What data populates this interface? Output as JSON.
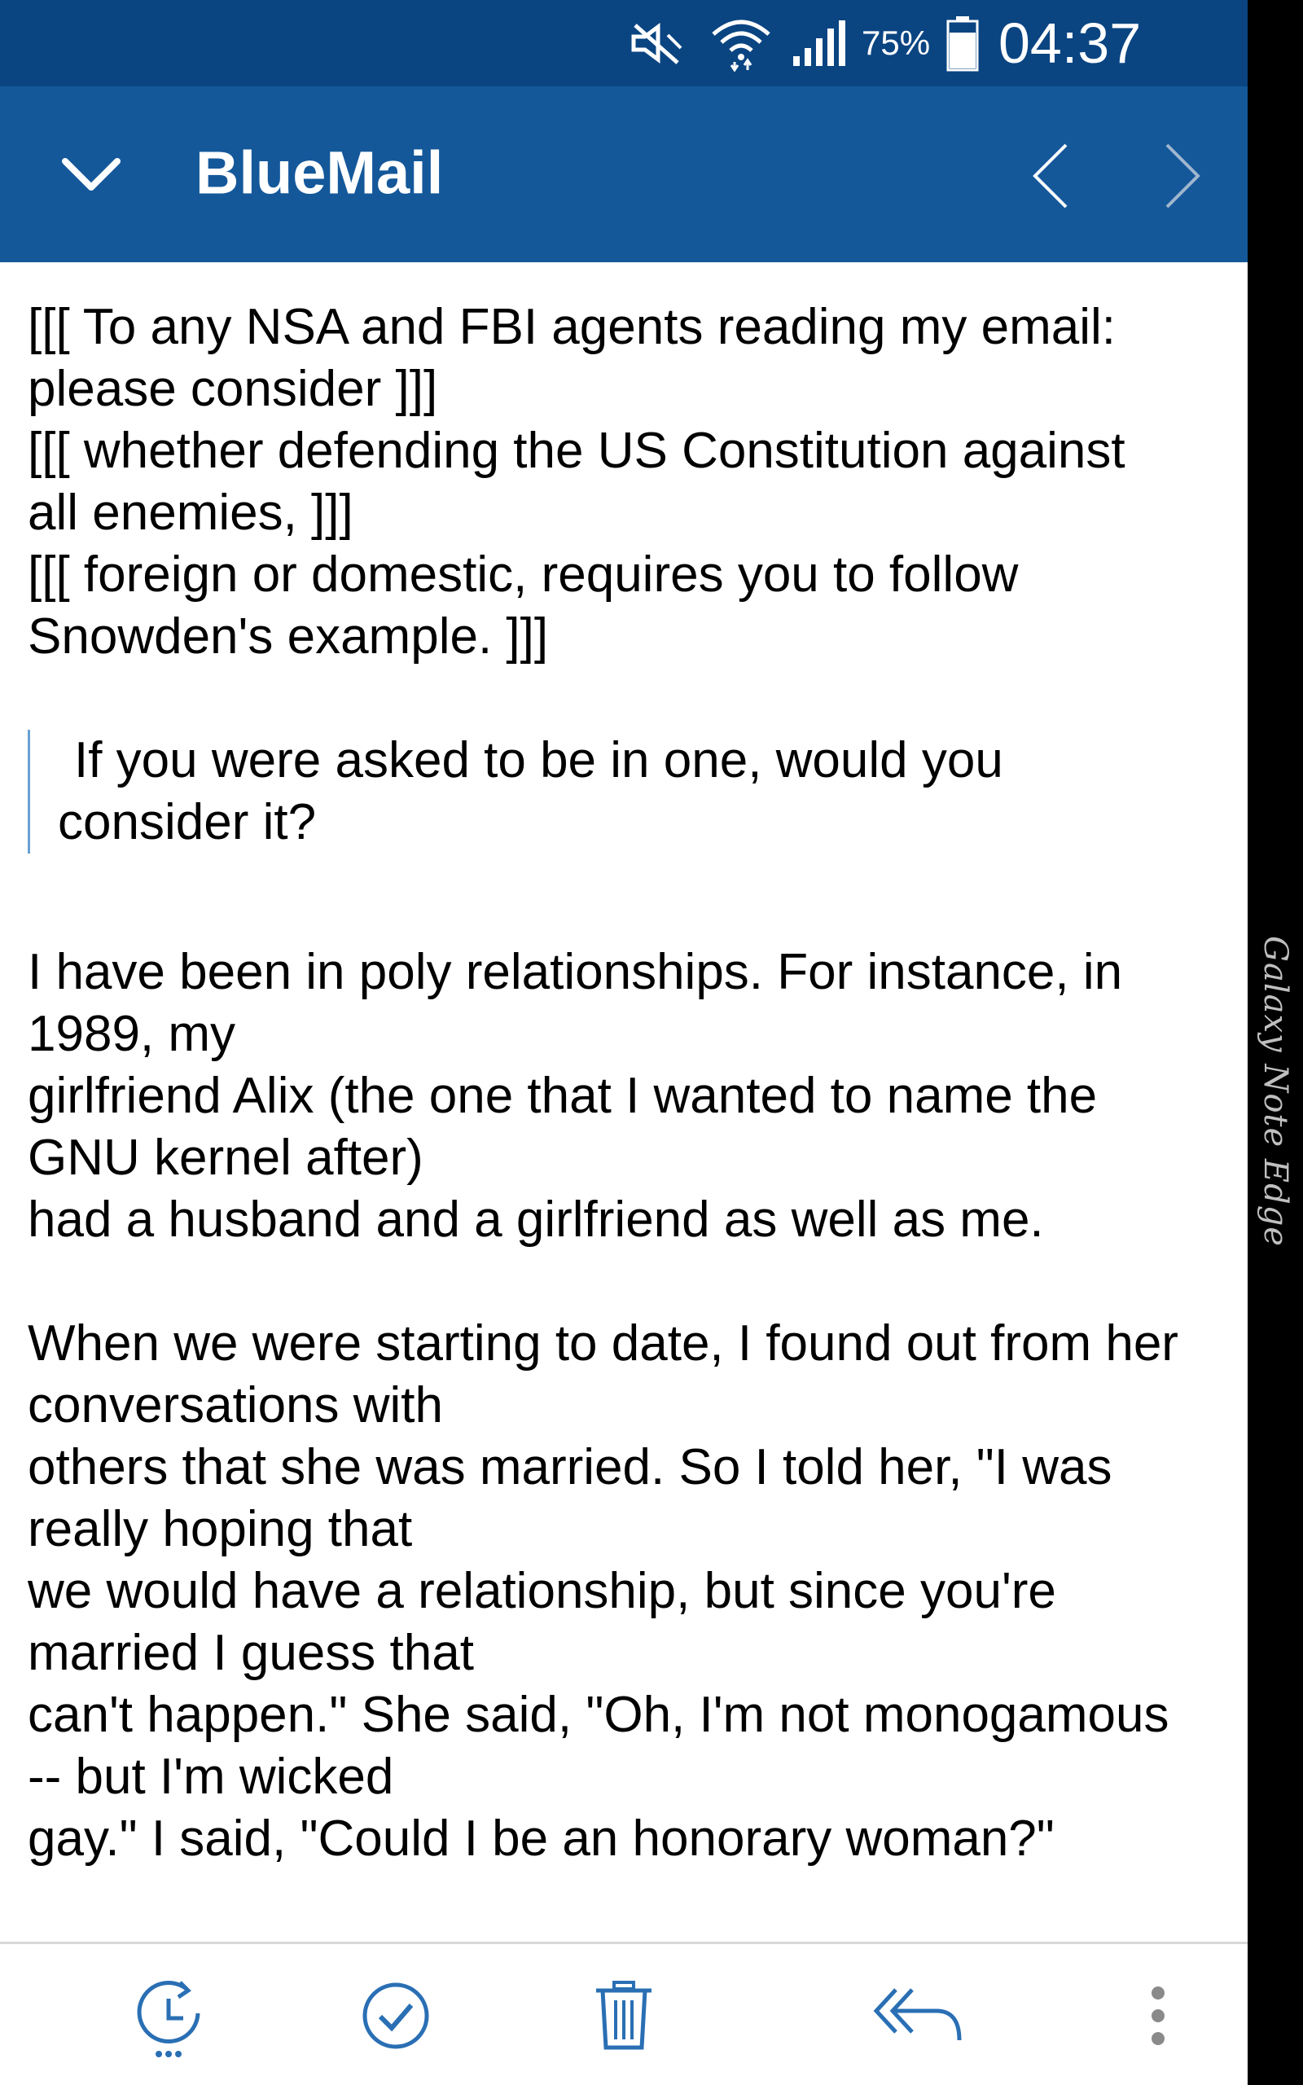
{
  "status_bar": {
    "battery_percent": "75%",
    "time": "04:37",
    "icons": [
      "mute-icon",
      "wifi-icon",
      "signal-icon",
      "battery-icon"
    ]
  },
  "app_bar": {
    "title": "BlueMail",
    "icons": [
      "chevron-down-icon",
      "chevron-left-icon",
      "chevron-right-icon"
    ]
  },
  "message": {
    "signature_lines": [
      "[[[ To any NSA and FBI agents reading my email:",
      "please consider    ]]]",
      "[[[ whether defending the US Constitution against",
      "all enemies,     ]]]",
      "[[[ foreign or domestic, requires you to follow",
      "Snowden's example. ]]]"
    ],
    "quote_lines": [
      "If you were asked to be in one, would you",
      "consider it?"
    ],
    "paragraph1_lines": [
      "I have been in poly relationships.  For instance, in",
      "1989, my",
      "girlfriend Alix (the one that I wanted to name the",
      "GNU kernel after)",
      "had a husband and a girlfriend as well as me."
    ],
    "paragraph2_lines": [
      "When we were starting to date, I found out from her",
      "conversations with",
      "others that she was married.  So I told her, \"I was",
      "really hoping that",
      "we would have a relationship, but since you're",
      "married I guess that",
      "can't happen.\"  She said, \"Oh, I'm not monogamous",
      "-- but I'm wicked",
      "gay.\"  I said, \"Could I be an honorary woman?\""
    ]
  },
  "bottom_bar": {
    "icons": [
      "snooze-icon",
      "done-check-icon",
      "trash-icon",
      "reply-all-icon",
      "more-vert-icon"
    ]
  },
  "device_edge": {
    "label": "Galaxy Note Edge"
  },
  "colors": {
    "status_bar": "#0a4582",
    "app_bar": "#14589a",
    "icon_blue": "#2a6fb4",
    "quote_border": "#6aa0d2"
  }
}
